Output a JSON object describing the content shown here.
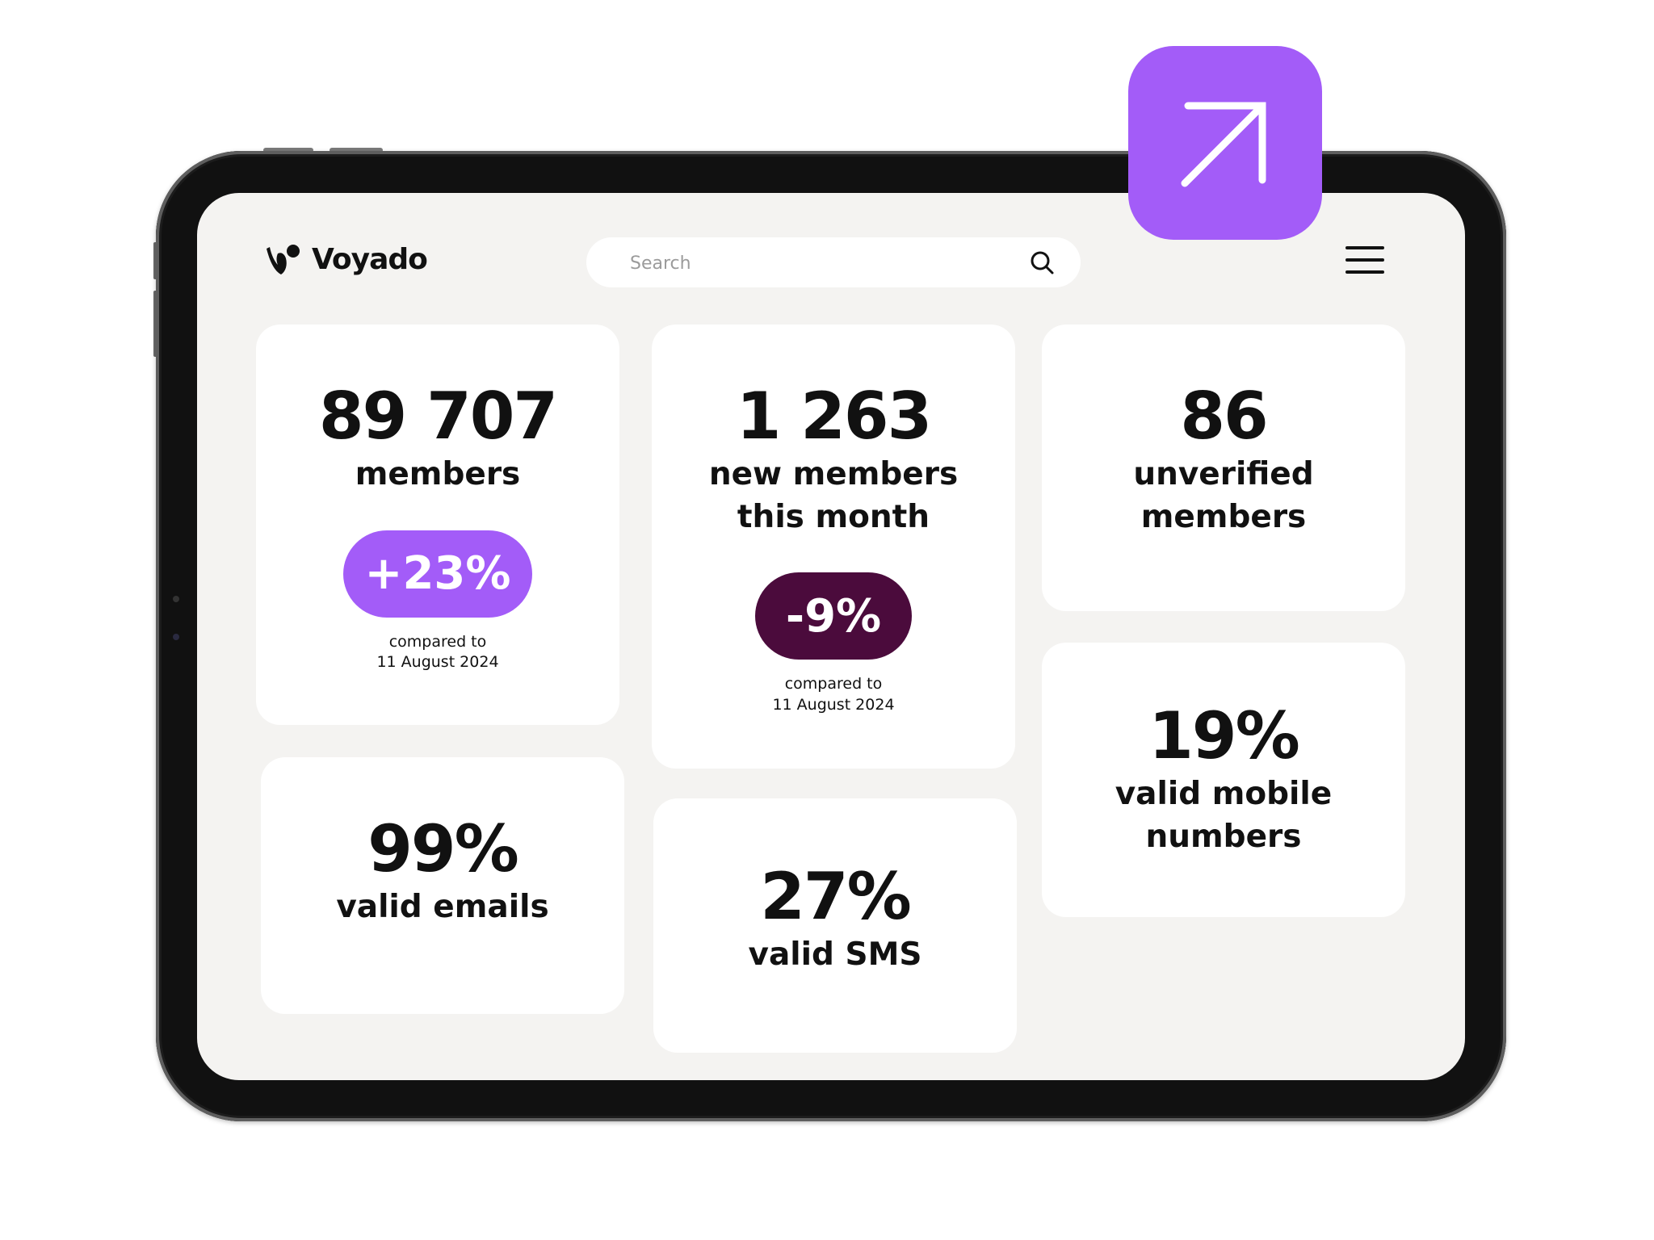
{
  "brand": {
    "name": "Voyado"
  },
  "search": {
    "placeholder": "Search",
    "value": ""
  },
  "colors": {
    "accent": "#a35cf8",
    "negative": "#4b0b3c",
    "screen_bg": "#f4f3f1",
    "card_bg": "#ffffff"
  },
  "icons": {
    "logo": "voyado-logo-icon",
    "search": "search-icon",
    "menu": "hamburger-menu-icon",
    "external": "arrow-up-right-icon"
  },
  "stats": {
    "members": {
      "value": "89 707",
      "label": "members",
      "change": "+23%",
      "compare_line1": "compared to",
      "compare_line2": "11 August 2024"
    },
    "new_members": {
      "value": "1 263",
      "label_line1": "new members",
      "label_line2": "this month",
      "change": "-9%",
      "compare_line1": "compared to",
      "compare_line2": "11 August 2024"
    },
    "unverified": {
      "value": "86",
      "label_line1": "unverified",
      "label_line2": "members"
    },
    "valid_emails": {
      "value": "99%",
      "label": "valid emails"
    },
    "valid_sms": {
      "value": "27%",
      "label": "valid SMS"
    },
    "valid_mobile": {
      "value": "19%",
      "label_line1": "valid mobile",
      "label_line2": "numbers"
    }
  }
}
